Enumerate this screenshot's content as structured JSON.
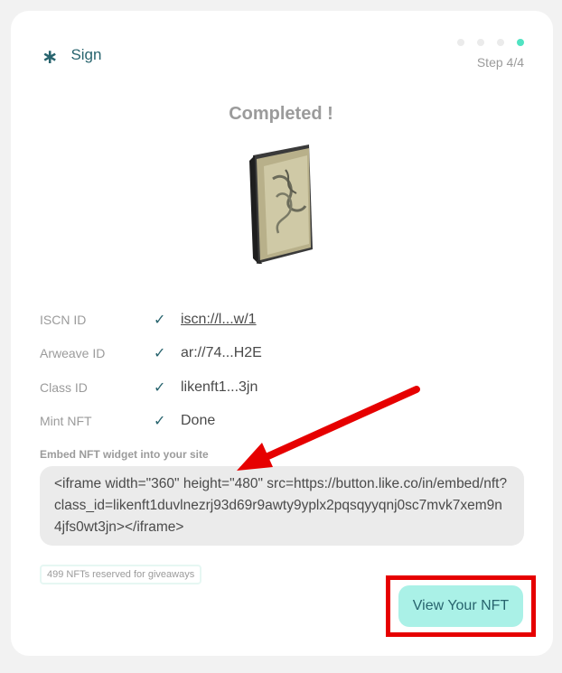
{
  "header": {
    "title": "Sign",
    "icon": "asterisk-icon"
  },
  "progress": {
    "step_label": "Step 4/4",
    "current_step": 4,
    "total_steps": 4
  },
  "status": {
    "title": "Completed !"
  },
  "nft": {
    "image": "nft-book-cover"
  },
  "details": [
    {
      "label": "ISCN ID",
      "value": "iscn://l...w/1"
    },
    {
      "label": "Arweave ID",
      "value": "ar://74...H2E"
    },
    {
      "label": "Class ID",
      "value": "likenft1...3jn"
    },
    {
      "label": "Mint NFT",
      "value": "Done"
    }
  ],
  "embed": {
    "label": "Embed NFT widget into your site",
    "code": "<iframe width=\"360\" height=\"480\" src=https://button.like.co/in/embed/nft?class_id=likenft1duvlnezrj93d69r9awty9yplx2pqsqyyqnj0sc7mvk7xem9n4jfs0wt3jn></iframe>"
  },
  "giveaway": {
    "label": "499 NFTs reserved for giveaways"
  },
  "actions": {
    "view_label": "View Your NFT"
  },
  "colors": {
    "accent": "#28646e",
    "button_bg": "#aaf1e7",
    "annotation_red": "#e60000",
    "active_dot": "#50e3c2"
  }
}
